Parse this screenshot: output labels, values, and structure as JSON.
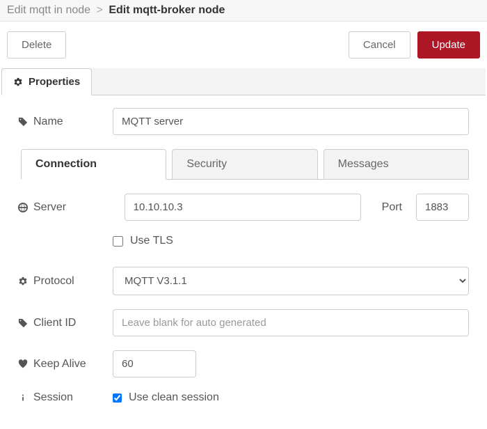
{
  "breadcrumb": {
    "parent": "Edit mqtt in node",
    "current": "Edit mqtt-broker node"
  },
  "buttons": {
    "delete": "Delete",
    "cancel": "Cancel",
    "update": "Update"
  },
  "tabs": {
    "properties": "Properties"
  },
  "fields": {
    "name_label": "Name",
    "name_value": "MQTT server",
    "server_label": "Server",
    "server_value": "10.10.10.3",
    "port_label": "Port",
    "port_value": "1883",
    "use_tls_label": "Use TLS",
    "protocol_label": "Protocol",
    "protocol_value": "MQTT V3.1.1",
    "clientid_label": "Client ID",
    "clientid_placeholder": "Leave blank for auto generated",
    "keepalive_label": "Keep Alive",
    "keepalive_value": "60",
    "session_label": "Session",
    "session_checkbox_label": "Use clean session"
  },
  "subtabs": {
    "connection": "Connection",
    "security": "Security",
    "messages": "Messages"
  }
}
